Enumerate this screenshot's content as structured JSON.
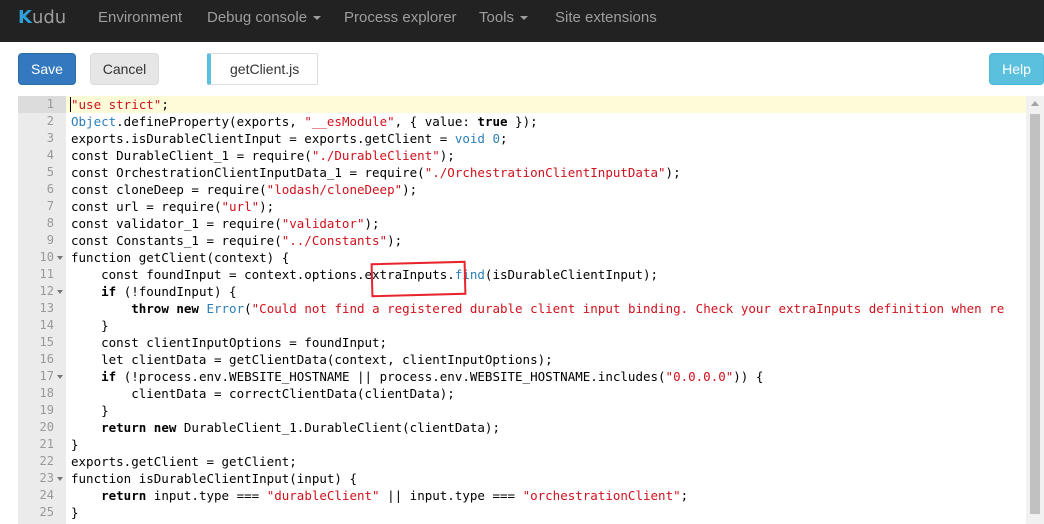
{
  "navbar": {
    "brand": {
      "k": "K",
      "rest": "udu"
    },
    "items": [
      {
        "label": "Environment",
        "dropdown": false
      },
      {
        "label": "Debug console",
        "dropdown": true
      },
      {
        "label": "Process explorer",
        "dropdown": false
      },
      {
        "label": "Tools",
        "dropdown": true
      },
      {
        "label": "Site extensions",
        "dropdown": false
      }
    ]
  },
  "toolbar": {
    "save_label": "Save",
    "cancel_label": "Cancel",
    "file_name": "getClient.js",
    "help_label": "Help"
  },
  "colors": {
    "navbar_bg": "#222222",
    "save_bg": "#3379c0",
    "help_bg": "#5bc0de",
    "active_line": "#fefbd8",
    "annotation": "#e8232c"
  },
  "editor": {
    "active_line": 1,
    "lines": [
      {
        "n": "1",
        "fold": false,
        "segs": [
          {
            "t": "\"use strict\"",
            "c": "str"
          },
          {
            "t": ";",
            "c": ""
          }
        ]
      },
      {
        "n": "2",
        "fold": false,
        "segs": [
          {
            "t": "Object",
            "c": "bi"
          },
          {
            "t": ".defineProperty(exports, ",
            "c": ""
          },
          {
            "t": "\"__esModule\"",
            "c": "str"
          },
          {
            "t": ", { value: ",
            "c": ""
          },
          {
            "t": "true",
            "c": "cb"
          },
          {
            "t": " });",
            "c": ""
          }
        ]
      },
      {
        "n": "3",
        "fold": false,
        "segs": [
          {
            "t": "exports.isDurableClientInput = exports.getClient = ",
            "c": ""
          },
          {
            "t": "void",
            "c": "bi"
          },
          {
            "t": " ",
            "c": ""
          },
          {
            "t": "0",
            "c": "bi"
          },
          {
            "t": ";",
            "c": ""
          }
        ]
      },
      {
        "n": "4",
        "fold": false,
        "segs": [
          {
            "t": "const DurableClient_1 = require(",
            "c": ""
          },
          {
            "t": "\"./DurableClient\"",
            "c": "str"
          },
          {
            "t": ");",
            "c": ""
          }
        ]
      },
      {
        "n": "5",
        "fold": false,
        "segs": [
          {
            "t": "const OrchestrationClientInputData_1 = require(",
            "c": ""
          },
          {
            "t": "\"./OrchestrationClientInputData\"",
            "c": "str"
          },
          {
            "t": ");",
            "c": ""
          }
        ]
      },
      {
        "n": "6",
        "fold": false,
        "segs": [
          {
            "t": "const cloneDeep = require(",
            "c": ""
          },
          {
            "t": "\"lodash/cloneDeep\"",
            "c": "str"
          },
          {
            "t": ");",
            "c": ""
          }
        ]
      },
      {
        "n": "7",
        "fold": false,
        "segs": [
          {
            "t": "const url = require(",
            "c": ""
          },
          {
            "t": "\"url\"",
            "c": "str"
          },
          {
            "t": ");",
            "c": ""
          }
        ]
      },
      {
        "n": "8",
        "fold": false,
        "segs": [
          {
            "t": "const validator_1 = require(",
            "c": ""
          },
          {
            "t": "\"validator\"",
            "c": "str"
          },
          {
            "t": ");",
            "c": ""
          }
        ]
      },
      {
        "n": "9",
        "fold": false,
        "segs": [
          {
            "t": "const Constants_1 = require(",
            "c": ""
          },
          {
            "t": "\"../Constants\"",
            "c": "str"
          },
          {
            "t": ");",
            "c": ""
          }
        ]
      },
      {
        "n": "10",
        "fold": true,
        "segs": [
          {
            "t": "function getClient(context) {",
            "c": ""
          }
        ]
      },
      {
        "n": "11",
        "fold": false,
        "segs": [
          {
            "t": "    const foundInput = context.options.extraInputs.",
            "c": ""
          },
          {
            "t": "find",
            "c": "bi"
          },
          {
            "t": "(isDurableClientInput);",
            "c": ""
          }
        ]
      },
      {
        "n": "12",
        "fold": true,
        "segs": [
          {
            "t": "    ",
            "c": ""
          },
          {
            "t": "if",
            "c": "cb"
          },
          {
            "t": " (!foundInput) {",
            "c": ""
          }
        ]
      },
      {
        "n": "13",
        "fold": false,
        "segs": [
          {
            "t": "        ",
            "c": ""
          },
          {
            "t": "throw new",
            "c": "cb"
          },
          {
            "t": " ",
            "c": ""
          },
          {
            "t": "Error",
            "c": "bi"
          },
          {
            "t": "(",
            "c": ""
          },
          {
            "t": "\"Could not find a registered durable client input binding. Check your extraInputs definition when re",
            "c": "str"
          }
        ]
      },
      {
        "n": "14",
        "fold": false,
        "segs": [
          {
            "t": "    }",
            "c": ""
          }
        ]
      },
      {
        "n": "15",
        "fold": false,
        "segs": [
          {
            "t": "    const clientInputOptions = foundInput;",
            "c": ""
          }
        ]
      },
      {
        "n": "16",
        "fold": false,
        "segs": [
          {
            "t": "    let clientData = getClientData(context, clientInputOptions);",
            "c": ""
          }
        ]
      },
      {
        "n": "17",
        "fold": true,
        "segs": [
          {
            "t": "    ",
            "c": ""
          },
          {
            "t": "if",
            "c": "cb"
          },
          {
            "t": " (!process.env.WEBSITE_HOSTNAME || process.env.WEBSITE_HOSTNAME.includes(",
            "c": ""
          },
          {
            "t": "\"0.0.0.0\"",
            "c": "str"
          },
          {
            "t": ")) {",
            "c": ""
          }
        ]
      },
      {
        "n": "18",
        "fold": false,
        "segs": [
          {
            "t": "        clientData = correctClientData(clientData);",
            "c": ""
          }
        ]
      },
      {
        "n": "19",
        "fold": false,
        "segs": [
          {
            "t": "    }",
            "c": ""
          }
        ]
      },
      {
        "n": "20",
        "fold": false,
        "segs": [
          {
            "t": "    ",
            "c": ""
          },
          {
            "t": "return new",
            "c": "cb"
          },
          {
            "t": " DurableClient_1.DurableClient(clientData);",
            "c": ""
          }
        ]
      },
      {
        "n": "21",
        "fold": false,
        "segs": [
          {
            "t": "}",
            "c": ""
          }
        ]
      },
      {
        "n": "22",
        "fold": false,
        "segs": [
          {
            "t": "exports.getClient = getClient;",
            "c": ""
          }
        ]
      },
      {
        "n": "23",
        "fold": true,
        "segs": [
          {
            "t": "function isDurableClientInput(input) {",
            "c": ""
          }
        ]
      },
      {
        "n": "24",
        "fold": false,
        "segs": [
          {
            "t": "    ",
            "c": ""
          },
          {
            "t": "return",
            "c": "cb"
          },
          {
            "t": " input.type === ",
            "c": ""
          },
          {
            "t": "\"durableClient\"",
            "c": "str"
          },
          {
            "t": " || input.type === ",
            "c": ""
          },
          {
            "t": "\"orchestrationClient\"",
            "c": "str"
          },
          {
            "t": ";",
            "c": ""
          }
        ]
      },
      {
        "n": "25",
        "fold": false,
        "segs": [
          {
            "t": "}",
            "c": ""
          }
        ]
      }
    ]
  }
}
